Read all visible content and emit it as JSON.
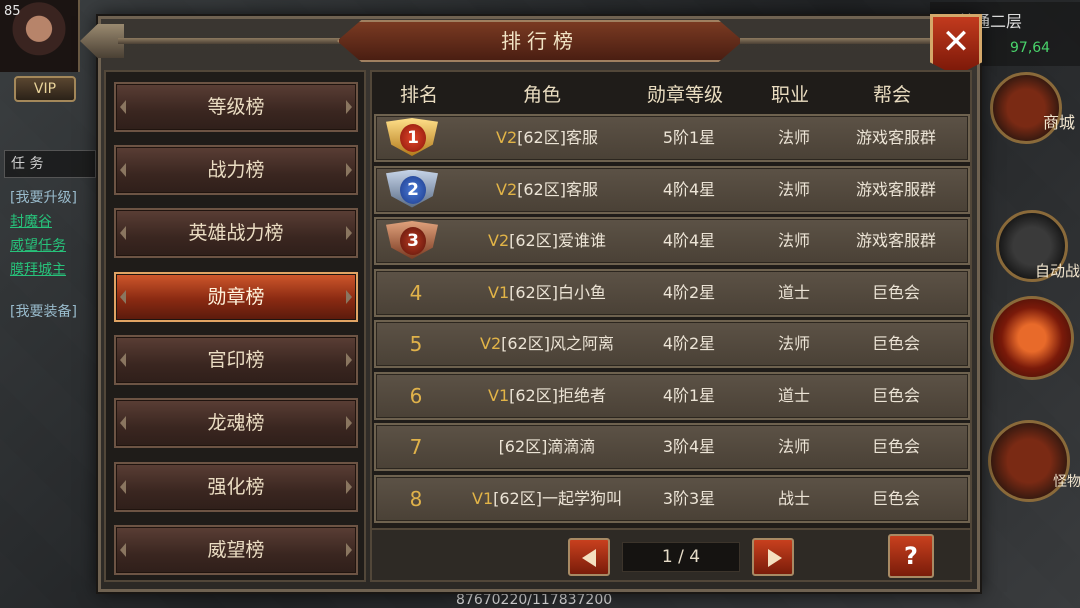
{
  "hud": {
    "level": "85",
    "vip_label": "VIP",
    "task_tab_label": "任 务",
    "tasks": [
      {
        "text": "[我要升级]",
        "style": "head"
      },
      {
        "text": "封魔谷",
        "style": "green"
      },
      {
        "text": "威望任务",
        "style": "green"
      },
      {
        "text": "膜拜城主",
        "style": "green"
      },
      {
        "text": "[我要装备]",
        "style": "head"
      }
    ],
    "map_name": "普通二层",
    "map_coords": "97,64",
    "shop_label": "商城",
    "auto_battle_label": "自动战斗",
    "monster_label": "怪物",
    "hp_text": "87670220/117837200"
  },
  "dialog": {
    "title": "排行榜",
    "close_label": "✕",
    "menu": [
      {
        "label": "等级榜",
        "active": false
      },
      {
        "label": "战力榜",
        "active": false
      },
      {
        "label": "英雄战力榜",
        "active": false
      },
      {
        "label": "勋章榜",
        "active": true
      },
      {
        "label": "官印榜",
        "active": false
      },
      {
        "label": "龙魂榜",
        "active": false
      },
      {
        "label": "强化榜",
        "active": false
      },
      {
        "label": "威望榜",
        "active": false
      }
    ],
    "table": {
      "headers": [
        "排名",
        "角色",
        "勋章等级",
        "职业",
        "帮会"
      ],
      "rows": [
        {
          "rank": "1",
          "vip": "V2",
          "name": "[62区]客服",
          "medal_level": "5阶1星",
          "job": "法师",
          "guild": "游戏客服群"
        },
        {
          "rank": "2",
          "vip": "V2",
          "name": "[62区]客服",
          "medal_level": "4阶4星",
          "job": "法师",
          "guild": "游戏客服群"
        },
        {
          "rank": "3",
          "vip": "V2",
          "name": "[62区]爱谁谁",
          "medal_level": "4阶4星",
          "job": "法师",
          "guild": "游戏客服群"
        },
        {
          "rank": "4",
          "vip": "V1",
          "name": "[62区]白小鱼",
          "medal_level": "4阶2星",
          "job": "道士",
          "guild": "巨色会"
        },
        {
          "rank": "5",
          "vip": "V2",
          "name": "[62区]风之阿离",
          "medal_level": "4阶2星",
          "job": "法师",
          "guild": "巨色会"
        },
        {
          "rank": "6",
          "vip": "V1",
          "name": "[62区]拒绝者",
          "medal_level": "4阶1星",
          "job": "道士",
          "guild": "巨色会"
        },
        {
          "rank": "7",
          "vip": "",
          "name": "[62区]滴滴滴",
          "medal_level": "3阶4星",
          "job": "法师",
          "guild": "巨色会"
        },
        {
          "rank": "8",
          "vip": "V1",
          "name": "[62区]一起学狗叫",
          "medal_level": "3阶3星",
          "job": "战士",
          "guild": "巨色会"
        }
      ]
    },
    "pager": {
      "page_text": "1 / 4",
      "help_label": "?"
    }
  }
}
